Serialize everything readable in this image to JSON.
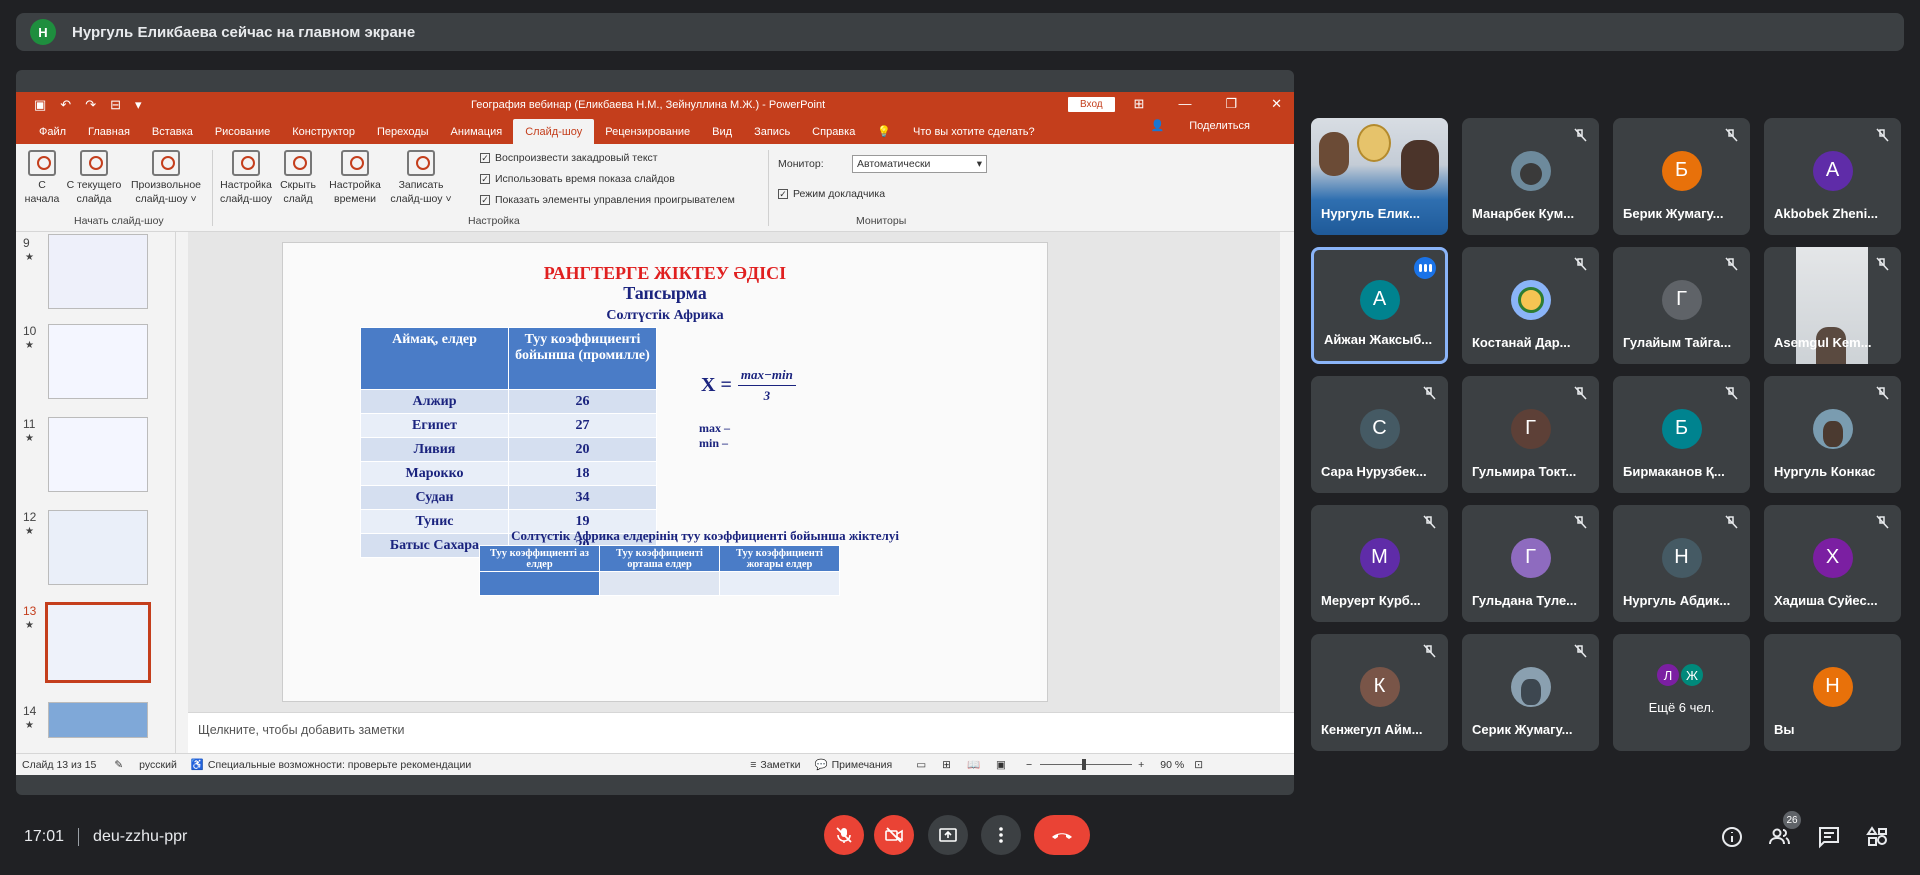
{
  "banner": {
    "avatar_letter": "Н",
    "text": "Нургуль Еликбаева сейчас на главном экране"
  },
  "ppt": {
    "doc_title": "География вебинар (Еликбаева Н.М., Зейнуллина М.Ж.) - PowerPoint",
    "login": "Вход",
    "tabs": [
      "Файл",
      "Главная",
      "Вставка",
      "Рисование",
      "Конструктор",
      "Переходы",
      "Анимация",
      "Слайд-шоу",
      "Рецензирование",
      "Вид",
      "Запись",
      "Справка",
      "Что вы хотите сделать?"
    ],
    "active_tab": "Слайд-шоу",
    "share": "Поделиться",
    "ribbon": {
      "from_start": "С\nначала",
      "from_current": "С текущего\nслайда",
      "custom": "Произвольное\nслайд-шоу ˅",
      "group1": "Начать слайд-шоу",
      "setup": "Настройка\nслайд-шоу",
      "hide": "Скрыть\nслайд",
      "timing": "Настройка\nвремени",
      "record": "Записать\nслайд-шоу ˅",
      "chk1": "Воспроизвести закадровый текст",
      "chk2": "Использовать время показа слайдов",
      "chk3": "Показать элементы управления проигрывателем",
      "group2": "Настройка",
      "monitor_label": "Монитор:",
      "monitor_value": "Автоматически",
      "presenter": "Режим докладчика",
      "group3": "Мониторы"
    },
    "thumbs": [
      "9",
      "10",
      "11",
      "12",
      "13",
      "14"
    ],
    "selected_thumb": "13",
    "slide": {
      "title": "РАНГТЕРГЕ ЖІКТЕУ ӘДІСІ",
      "subtitle": "Тапсырма",
      "region": "Солтүстік Африка",
      "col1": "Аймақ, елдер",
      "col2": "Туу коэффициенті бойынша (промилле)",
      "rows": [
        [
          "Алжир",
          "26"
        ],
        [
          "Египет",
          "27"
        ],
        [
          "Ливия",
          "20"
        ],
        [
          "Марокко",
          "18"
        ],
        [
          "Судан",
          "34"
        ],
        [
          "Тунис",
          "19"
        ],
        [
          "Батыс Сахара",
          "20"
        ]
      ],
      "formula_x": "X =",
      "formula_num": "max−min",
      "formula_den": "3",
      "max": "max –",
      "min": "min –",
      "caption": "Солтүстік Африка елдерінің туу коэффициенті бойынша жіктелуі",
      "t2_headers": [
        "Туу коэффициенті аз елдер",
        "Туу коэффициенті орташа елдер",
        "Туу коэффициенті жоғары елдер"
      ]
    },
    "notes_placeholder": "Щелкните, чтобы добавить заметки",
    "status": {
      "slide": "Слайд 13 из 15",
      "lang": "русский",
      "access": "Специальные возможности: проверьте рекомендации",
      "notes": "Заметки",
      "comments": "Примечания",
      "zoom": "90 %"
    }
  },
  "participants": [
    {
      "name": "Нургуль Елик...",
      "letter": "",
      "color": "",
      "photo": true
    },
    {
      "name": "Манарбек Кум...",
      "letter": "",
      "color": "#6d8a9c",
      "photo": true
    },
    {
      "name": "Берик Жумагу...",
      "letter": "Б",
      "color": "#e8710a"
    },
    {
      "name": "Akbobek Zheni...",
      "letter": "A",
      "color": "#5f2ca8"
    },
    {
      "name": "Айжан Жаксыб...",
      "letter": "A",
      "color": "#00838f"
    },
    {
      "name": "Костанай Дар...",
      "letter": "",
      "color": "#8ab4f8",
      "photo": true
    },
    {
      "name": "Гулайым Тайга...",
      "letter": "Г",
      "color": "#5f6368"
    },
    {
      "name": "Asemgul Kem...",
      "letter": "",
      "color": "",
      "photo": true
    },
    {
      "name": "Сара Нурузбек...",
      "letter": "С",
      "color": "#455a64"
    },
    {
      "name": "Гульмира Токт...",
      "letter": "Г",
      "color": "#5d4037"
    },
    {
      "name": "Бирмаканов Қ...",
      "letter": "Б",
      "color": "#00838f"
    },
    {
      "name": "Нургуль Конкас",
      "letter": "",
      "color": "#7a9cb0",
      "photo": true
    },
    {
      "name": "Меруерт Курб...",
      "letter": "М",
      "color": "#5f2ca8"
    },
    {
      "name": "Гульдана Туле...",
      "letter": "Г",
      "color": "#8e6bbf"
    },
    {
      "name": "Нургуль Абдик...",
      "letter": "Н",
      "color": "#455a64"
    },
    {
      "name": "Хадиша Суйес...",
      "letter": "Х",
      "color": "#7b1fa2"
    },
    {
      "name": "Кенжегул Айм...",
      "letter": "К",
      "color": "#795548"
    },
    {
      "name": "Серик Жумагу...",
      "letter": "",
      "color": "#8aa0b0",
      "photo": true
    },
    {
      "name": "Ещё 6 чел.",
      "letter": "",
      "color": ""
    },
    {
      "name": "Вы",
      "letter": "Н",
      "color": "#e8710a"
    }
  ],
  "more_avatars": [
    "Л",
    "Ж"
  ],
  "bottom": {
    "time": "17:01",
    "meeting_code": "deu-zzhu-ppr",
    "people_count": "26"
  }
}
